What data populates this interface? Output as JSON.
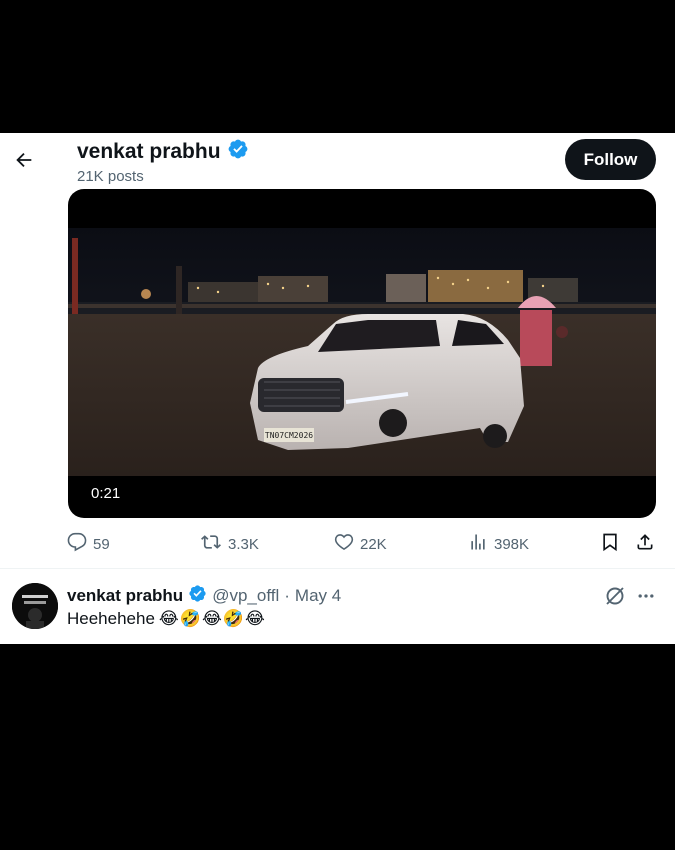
{
  "header": {
    "display_name": "venkat prabhu",
    "posts_count": "21K posts",
    "follow_label": "Follow"
  },
  "video": {
    "duration": "0:21",
    "plate_text": "TN07CM2026"
  },
  "actions": {
    "replies": "59",
    "reposts": "3.3K",
    "likes": "22K",
    "views": "398K"
  },
  "reply": {
    "display_name": "venkat prabhu",
    "handle": "@vp_offl",
    "separator": "·",
    "date": "May 4",
    "text": "Heehehehe",
    "emojis": [
      "😂",
      "🤣",
      "😂",
      "🤣",
      "😂"
    ]
  },
  "colors": {
    "text_primary": "#0f1419",
    "text_secondary": "#536471",
    "verified_blue": "#1d9bf0",
    "follow_bg": "#0f1419",
    "background": "#ffffff"
  },
  "icons": [
    "back-arrow-icon",
    "verified-badge-icon",
    "reply-icon",
    "repost-icon",
    "like-icon",
    "views-icon",
    "bookmark-icon",
    "share-icon",
    "grok-icon",
    "more-icon"
  ]
}
